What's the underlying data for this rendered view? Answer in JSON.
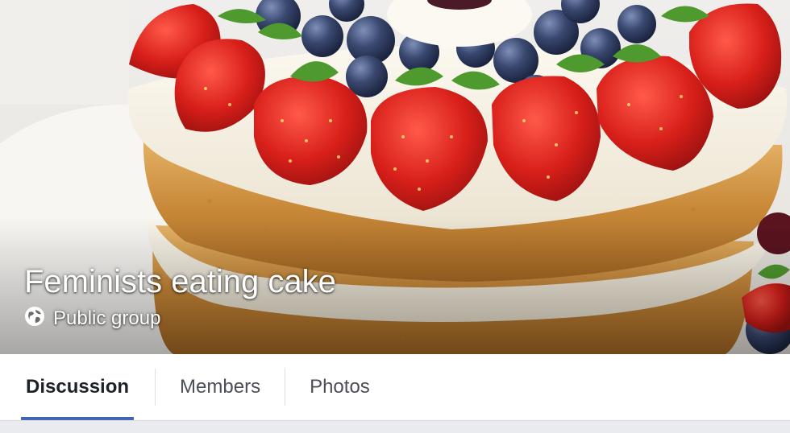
{
  "group": {
    "name": "Feminists eating cake",
    "privacy_label": "Public group",
    "privacy_icon": "globe-icon"
  },
  "cover": {
    "subject": "cake-photo"
  },
  "tabs": [
    {
      "label": "Discussion",
      "active": true
    },
    {
      "label": "Members",
      "active": false
    },
    {
      "label": "Photos",
      "active": false
    }
  ],
  "colors": {
    "accent": "#4267b2",
    "page_background": "#e9ebee",
    "tab_text": "#4b4f56",
    "tab_text_active": "#1d2129"
  }
}
